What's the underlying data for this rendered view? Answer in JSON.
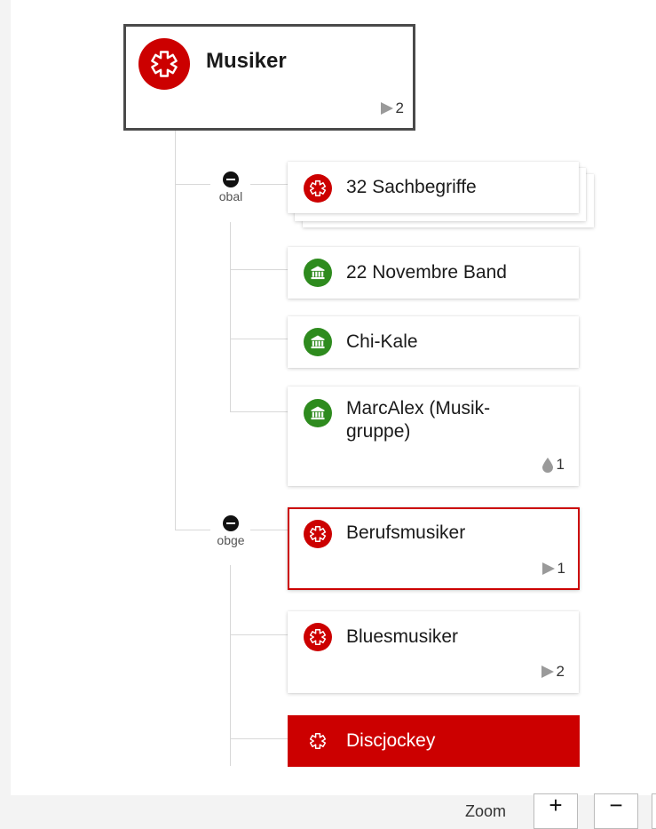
{
  "colors": {
    "red": "#cc0000",
    "green": "#2e8b1e",
    "border_dark": "#4a4a4a"
  },
  "root": {
    "title": "Musiker",
    "icon": "asterisk-icon",
    "child_count": "2"
  },
  "groups": [
    {
      "toggle_label": "obal",
      "items": [
        {
          "label": "32 Sachbegriffe",
          "icon": "asterisk-icon",
          "color": "red",
          "stacked": true
        },
        {
          "label": "22 Novembre Band",
          "icon": "building-icon",
          "color": "green"
        },
        {
          "label": "Chi-Kale",
          "icon": "building-icon",
          "color": "green"
        },
        {
          "label_line1": "MarcAlex (Musik-",
          "label_line2": "gruppe)",
          "icon": "building-icon",
          "color": "green",
          "drop_count": "1"
        }
      ]
    },
    {
      "toggle_label": "obge",
      "items": [
        {
          "label": "Berufsmusiker",
          "icon": "asterisk-icon",
          "color": "red",
          "child_count": "1",
          "selected": true
        },
        {
          "label": "Bluesmusiker",
          "icon": "asterisk-icon",
          "color": "red",
          "child_count": "2"
        },
        {
          "label": "Discjockey",
          "icon": "asterisk-icon",
          "color": "red",
          "highlighted": true
        }
      ]
    }
  ],
  "zoom": {
    "label": "Zoom",
    "in_label": "+",
    "out_label": "−"
  }
}
